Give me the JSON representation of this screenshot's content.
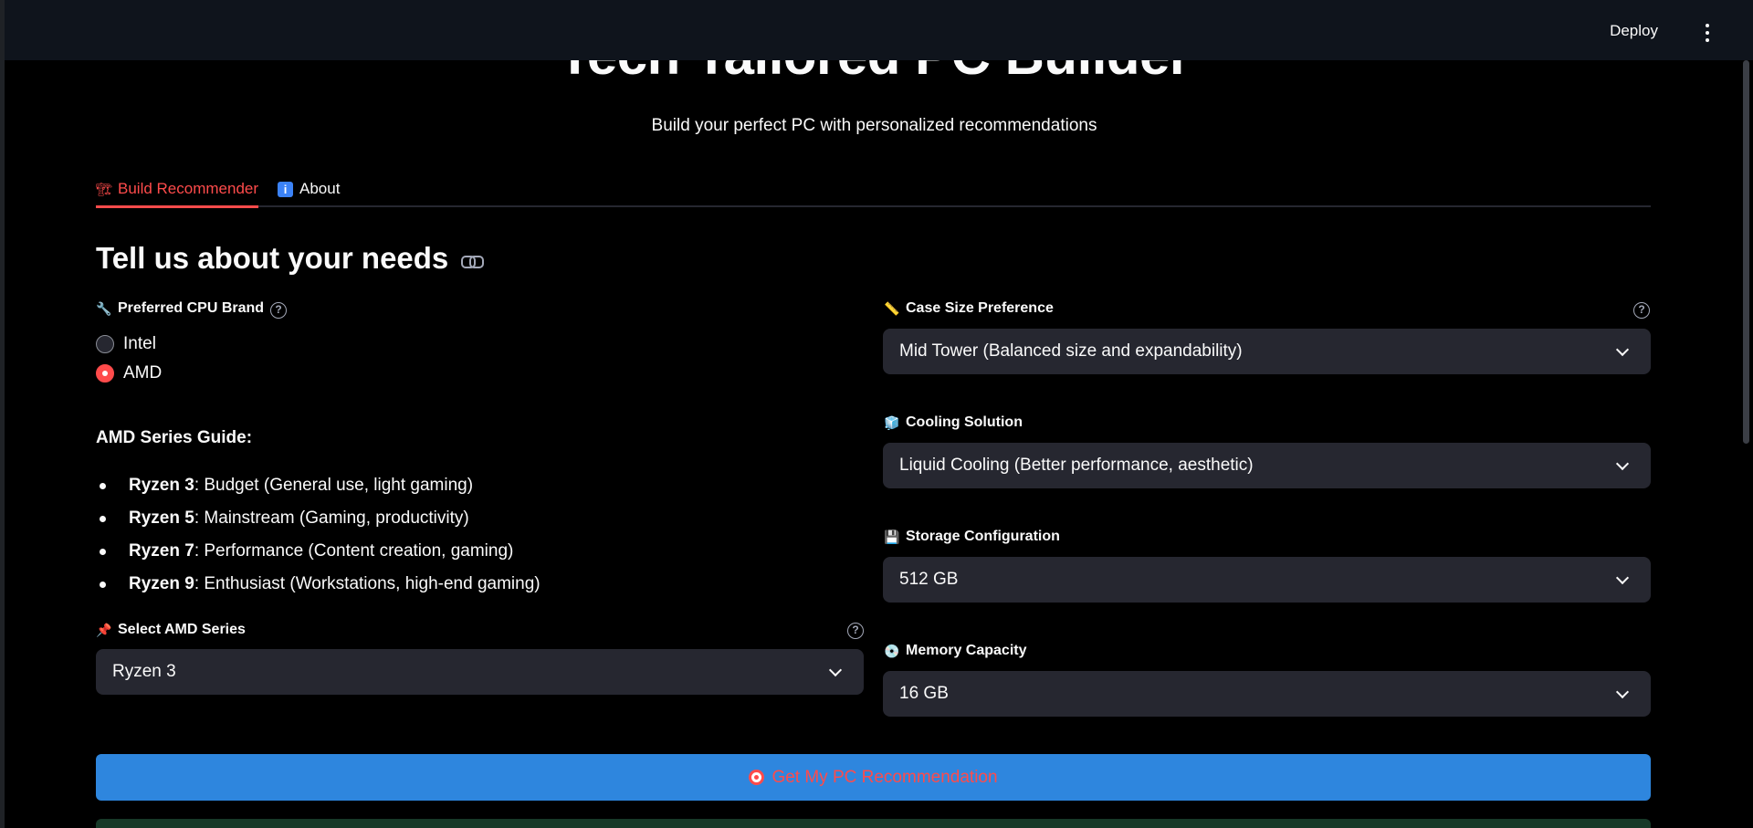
{
  "header": {
    "deploy_label": "Deploy"
  },
  "page": {
    "title": "Tech Tailored PC Builder",
    "subtitle": "Build your perfect PC with personalized recommendations"
  },
  "tabs": [
    {
      "label": "Build Recommender",
      "icon": "bricks-icon",
      "active": true
    },
    {
      "label": "About",
      "icon": "info-icon",
      "active": false
    }
  ],
  "section": {
    "heading": "Tell us about your needs"
  },
  "cpu": {
    "label": "Preferred CPU Brand",
    "options": [
      "Intel",
      "AMD"
    ],
    "selected": "AMD"
  },
  "guide": {
    "title": "AMD Series Guide:",
    "items": [
      {
        "name": "Ryzen 3",
        "desc": ": Budget (General use, light gaming)"
      },
      {
        "name": "Ryzen 5",
        "desc": ": Mainstream (Gaming, productivity)"
      },
      {
        "name": "Ryzen 7",
        "desc": ": Performance (Content creation, gaming)"
      },
      {
        "name": "Ryzen 9",
        "desc": ": Enthusiast (Workstations, high-end gaming)"
      }
    ]
  },
  "series": {
    "label": "Select AMD Series",
    "value": "Ryzen 3"
  },
  "case_size": {
    "label": "Case Size Preference",
    "value": "Mid Tower (Balanced size and expandability)"
  },
  "cooling": {
    "label": "Cooling Solution",
    "value": "Liquid Cooling (Better performance, aesthetic)"
  },
  "storage": {
    "label": "Storage Configuration",
    "value": "512 GB"
  },
  "memory": {
    "label": "Memory Capacity",
    "value": "16 GB"
  },
  "action": {
    "label": "Get My PC Recommendation"
  },
  "colors": {
    "accent": "#ff4b4b",
    "button": "#2e86de",
    "select_bg": "#262730",
    "header_bg": "#0f141c"
  }
}
